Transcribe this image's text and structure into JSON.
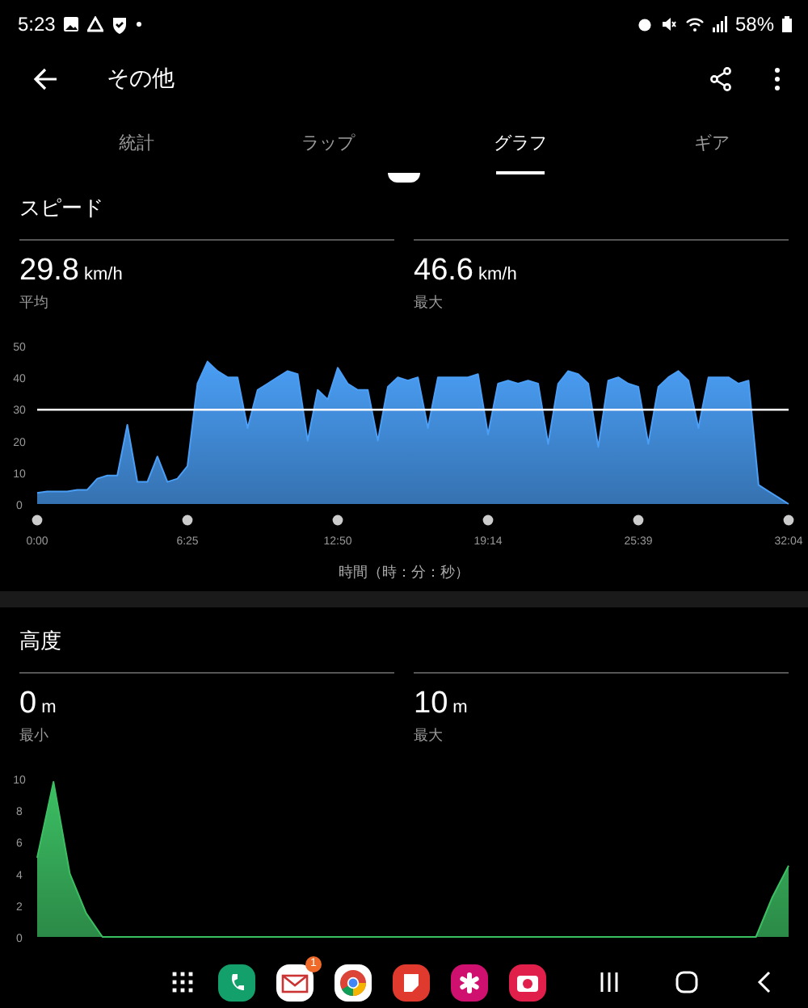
{
  "status_bar": {
    "time": "5:23",
    "battery": "58%"
  },
  "app_bar": {
    "title": "その他"
  },
  "tabs": [
    {
      "label": "統計",
      "selected": false
    },
    {
      "label": "ラップ",
      "selected": false
    },
    {
      "label": "グラフ",
      "selected": true
    },
    {
      "label": "ギア",
      "selected": false
    }
  ],
  "sections": [
    {
      "title": "スピード",
      "average_line": true,
      "stats": [
        {
          "value": "29.8",
          "unit": "km/h",
          "label": "平均"
        },
        {
          "value": "46.6",
          "unit": "km/h",
          "label": "最大"
        }
      ],
      "chart_data": {
        "type": "area",
        "xlabel": "時間（時：分：秒）",
        "ylim": [
          0,
          50
        ],
        "yticks": [
          0,
          10,
          20,
          30,
          40,
          50
        ],
        "categories": [
          "0:00",
          null,
          null,
          null,
          null,
          null,
          null,
          null,
          null,
          null,
          null,
          null,
          null,
          null,
          null,
          "6:25",
          null,
          null,
          null,
          null,
          null,
          null,
          null,
          null,
          null,
          null,
          null,
          null,
          null,
          null,
          "12:50",
          null,
          null,
          null,
          null,
          null,
          null,
          null,
          null,
          null,
          null,
          null,
          null,
          null,
          null,
          "19:14",
          null,
          null,
          null,
          null,
          null,
          null,
          null,
          null,
          null,
          null,
          null,
          null,
          null,
          null,
          "25:39",
          null,
          null,
          null,
          null,
          null,
          null,
          null,
          null,
          null,
          null,
          null,
          null,
          null,
          null,
          "32:04"
        ],
        "series": [
          {
            "color": "#4a9ef5",
            "values": [
              3.5,
              4,
              4,
              4,
              4.5,
              4.5,
              8,
              9,
              9,
              25,
              7,
              7,
              15,
              7,
              8,
              12,
              38,
              45,
              42,
              40,
              40,
              24,
              36,
              38,
              40,
              42,
              41,
              20,
              36,
              33,
              43,
              38,
              36,
              36,
              20,
              37,
              40,
              39,
              40,
              24,
              40,
              40,
              40,
              40,
              41,
              22,
              38,
              39,
              38,
              39,
              38,
              19,
              38,
              42,
              41,
              38,
              18,
              39,
              40,
              38,
              37,
              19,
              37,
              40,
              42,
              39,
              24,
              40,
              40,
              40,
              38,
              39,
              6,
              4,
              2,
              0
            ]
          }
        ]
      }
    },
    {
      "title": "高度",
      "average_line": false,
      "stats": [
        {
          "value": "0",
          "unit": "m",
          "label": "最小"
        },
        {
          "value": "10",
          "unit": "m",
          "label": "最大"
        }
      ],
      "chart_data": {
        "type": "area",
        "ylim": [
          0,
          10
        ],
        "yticks": [
          0,
          2,
          4,
          6,
          8,
          10
        ],
        "categories": [
          null,
          null,
          null,
          null,
          null,
          null,
          null,
          null,
          null,
          null,
          null,
          null,
          null,
          null,
          null,
          null,
          null,
          null,
          null,
          null,
          null,
          null,
          null,
          null,
          null,
          null,
          null,
          null,
          null,
          null,
          null,
          null,
          null,
          null,
          null,
          null,
          null,
          null,
          null,
          null,
          null,
          null,
          null,
          null,
          null,
          null,
          null
        ],
        "series": [
          {
            "color": "#3cbf63",
            "values": [
              5,
              9.8,
              4,
              1.5,
              0,
              0,
              0,
              0,
              0,
              0,
              0,
              0,
              0,
              0,
              0,
              0,
              0,
              0,
              0,
              0,
              0,
              0,
              0,
              0,
              0,
              0,
              0,
              0,
              0,
              0,
              0,
              0,
              0,
              0,
              0,
              0,
              0,
              0,
              0,
              0,
              0,
              0,
              0,
              0,
              0,
              2.5,
              4.5
            ]
          }
        ]
      }
    }
  ],
  "taskbar": {
    "apps": [
      {
        "kind": "grid"
      },
      {
        "kind": "phone"
      },
      {
        "kind": "mail",
        "badge": "1"
      },
      {
        "kind": "browser"
      },
      {
        "kind": "notes"
      },
      {
        "kind": "flower"
      },
      {
        "kind": "camera"
      }
    ],
    "nav": [
      {
        "kind": "recents"
      },
      {
        "kind": "home"
      },
      {
        "kind": "back"
      }
    ]
  }
}
